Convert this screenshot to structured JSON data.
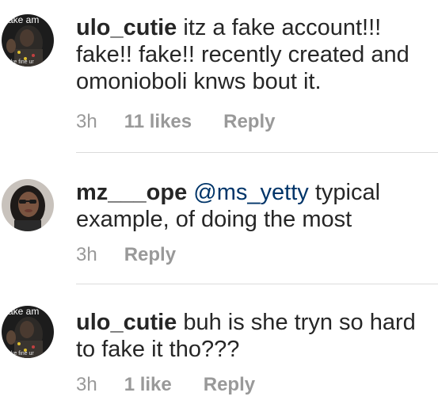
{
  "comments": [
    {
      "avatar_caption_top": "ake am",
      "avatar_caption_bottom": "ake fine ur",
      "username": "ulo_cutie",
      "mention": "",
      "text": " itz a fake account!!! fake!! fake!! recently created and omonioboli knws bout it.",
      "time": "3h",
      "likes": "11 likes",
      "reply": "Reply"
    },
    {
      "username": "mz___ope",
      "mention": " @ms_yetty",
      "text": " typical example, of doing the most",
      "time": "3h",
      "reply": "Reply"
    },
    {
      "avatar_caption_top": "ake am",
      "avatar_caption_bottom": "ake fine ur",
      "username": "ulo_cutie",
      "mention": "",
      "text": " buh is she tryn so hard to fake it tho???",
      "time": "3h",
      "likes": "1 like",
      "reply": "Reply"
    }
  ]
}
